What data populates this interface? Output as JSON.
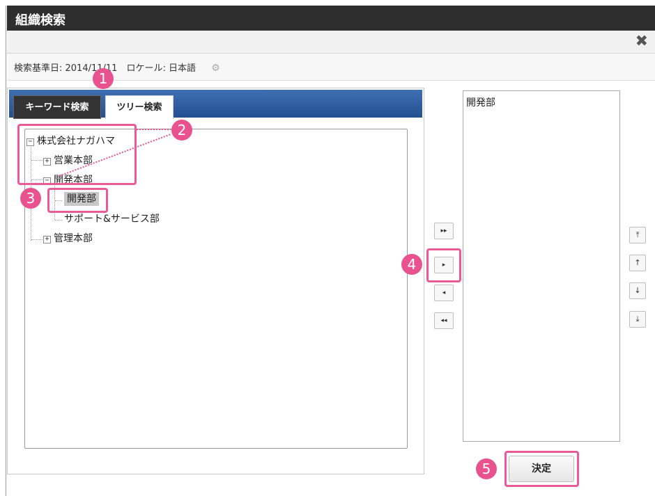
{
  "dialog": {
    "title": "組織検索"
  },
  "toolbar": {
    "close_icon": "close-icon"
  },
  "info": {
    "text": "検索基準日: 2014/11/11　ロケール: 日本語",
    "gear_icon": "gear-icon"
  },
  "tabs": [
    {
      "label": "キーワード検索",
      "active": false
    },
    {
      "label": "ツリー検索",
      "active": true
    }
  ],
  "tree": {
    "root": "株式会社ナガハマ",
    "items": [
      {
        "label": "営業本部",
        "toggle": "+"
      },
      {
        "label": "開発本部",
        "toggle": "−"
      },
      {
        "label": "開発部",
        "selected": true
      },
      {
        "label": "サポート&サービス部"
      },
      {
        "label": "管理本部",
        "toggle": "+"
      }
    ],
    "root_toggle": "−"
  },
  "movers": {
    "add_all": "▸▸",
    "add": "▸",
    "remove": "◂",
    "remove_all": "◂◂"
  },
  "sorters": {
    "top": "⤒",
    "up": "↑",
    "down": "↓",
    "bottom": "⤓"
  },
  "results": [
    "開発部"
  ],
  "decide_button": {
    "label": "決定"
  },
  "annotations": [
    "1",
    "2",
    "3",
    "4",
    "5"
  ],
  "colors": {
    "accent": "#e8538f",
    "title_bar": "#2e2e2e",
    "tab_strip": "#2f5fa3"
  }
}
